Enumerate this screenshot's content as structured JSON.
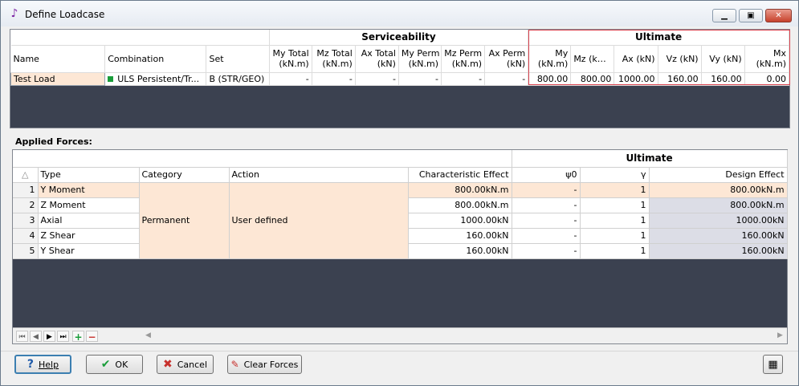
{
  "window": {
    "title": "Define Loadcase"
  },
  "loadcase": {
    "groups": {
      "serviceability": "Serviceability",
      "ultimate": "Ultimate"
    },
    "headers": {
      "name": "Name",
      "combination": "Combination",
      "set": "Set",
      "my_total": [
        "My Total",
        "(kN.m)"
      ],
      "mz_total": [
        "Mz Total",
        "(kN.m)"
      ],
      "ax_total": [
        "Ax Total",
        "(kN)"
      ],
      "my_perm": [
        "My Perm",
        "(kN.m)"
      ],
      "mz_perm": [
        "Mz Perm",
        "(kN.m)"
      ],
      "ax_perm": [
        "Ax Perm",
        "(kN)"
      ],
      "my": [
        "My",
        "(kN.m)"
      ],
      "mz": "Mz (kN.m)",
      "ax": "Ax (kN)",
      "vz": "Vz (kN)",
      "vy": "Vy (kN)",
      "mx": [
        "Mx",
        "(kN.m)"
      ]
    },
    "row": {
      "name": "Test Load",
      "combination": "ULS Persistent/Tr...",
      "set": "B (STR/GEO)",
      "my_total": "-",
      "mz_total": "-",
      "ax_total": "-",
      "my_perm": "-",
      "mz_perm": "-",
      "ax_perm": "-",
      "my": "800.00",
      "mz": "800.00",
      "ax": "1000.00",
      "vz": "160.00",
      "vy": "160.00",
      "mx": "0.00"
    }
  },
  "applied_forces": {
    "label": "Applied Forces:",
    "group_ultimate": "Ultimate",
    "sort_icon": "△",
    "headers": {
      "type": "Type",
      "category": "Category",
      "action": "Action",
      "char": "Characteristic Effect",
      "psi": "ψ0",
      "gamma": "γ",
      "design": "Design Effect"
    },
    "category": "Permanent",
    "action": "User defined",
    "rows": [
      {
        "n": "1",
        "type": "Y Moment",
        "char": "800.00kN.m",
        "psi": "-",
        "gamma": "1",
        "design": "800.00kN.m"
      },
      {
        "n": "2",
        "type": "Z Moment",
        "char": "800.00kN.m",
        "psi": "-",
        "gamma": "1",
        "design": "800.00kN.m"
      },
      {
        "n": "3",
        "type": "Axial",
        "char": "1000.00kN",
        "psi": "-",
        "gamma": "1",
        "design": "1000.00kN"
      },
      {
        "n": "4",
        "type": "Z Shear",
        "char": "160.00kN",
        "psi": "-",
        "gamma": "1",
        "design": "160.00kN"
      },
      {
        "n": "5",
        "type": "Y Shear",
        "char": "160.00kN",
        "psi": "-",
        "gamma": "1",
        "design": "160.00kN"
      }
    ]
  },
  "buttons": {
    "help": "Help",
    "ok": "OK",
    "cancel": "Cancel",
    "clear": "Clear Forces"
  },
  "colors": {
    "ultimate_border": "#d9434f",
    "row_highlight": "#fde7d5",
    "grid_bg": "#3b4150"
  }
}
